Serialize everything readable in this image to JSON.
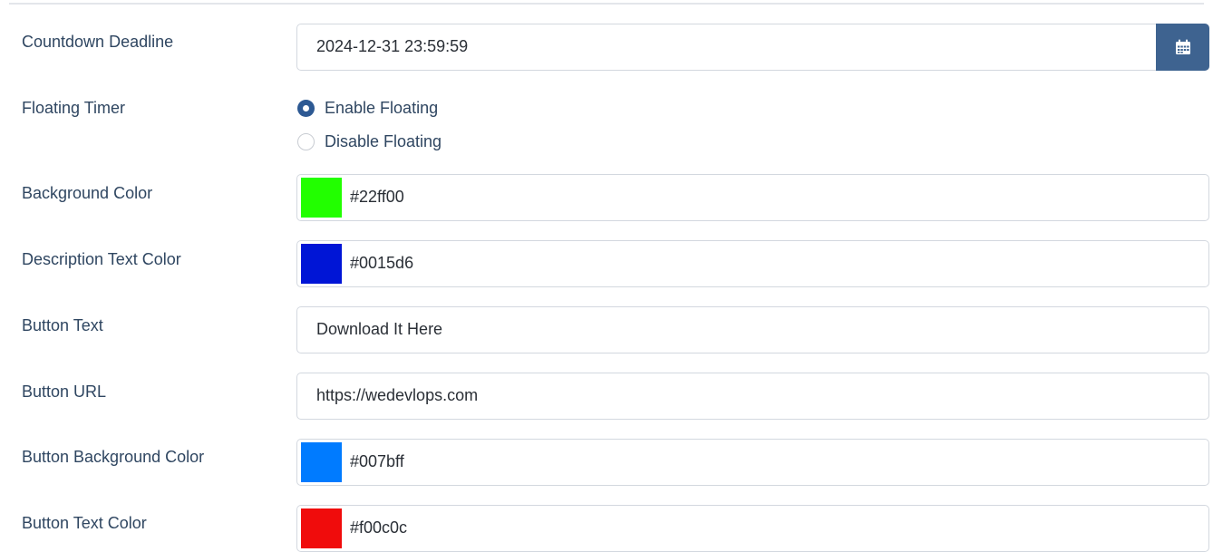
{
  "form": {
    "countdown_deadline": {
      "label": "Countdown Deadline",
      "value": "2024-12-31 23:59:59",
      "button_icon": "calendar-icon"
    },
    "floating_timer": {
      "label": "Floating Timer",
      "options": [
        {
          "label": "Enable Floating",
          "selected": true
        },
        {
          "label": "Disable Floating",
          "selected": false
        }
      ]
    },
    "background_color": {
      "label": "Background Color",
      "value": "#22ff00",
      "swatch": "#22ff00"
    },
    "description_text_color": {
      "label": "Description Text Color",
      "value": "#0015d6",
      "swatch": "#0015d6"
    },
    "button_text": {
      "label": "Button Text",
      "value": "Download It Here"
    },
    "button_url": {
      "label": "Button URL",
      "value": "https://wedevlops.com"
    },
    "button_background_color": {
      "label": "Button Background Color",
      "value": "#007bff",
      "swatch": "#007bff"
    },
    "button_text_color": {
      "label": "Button Text Color",
      "value": "#f00c0c",
      "swatch": "#f00c0c"
    }
  },
  "theme": {
    "label_color": "#2f4661",
    "calendar_button_color": "#3e6390",
    "radio_selected_color": "#2d5993"
  }
}
